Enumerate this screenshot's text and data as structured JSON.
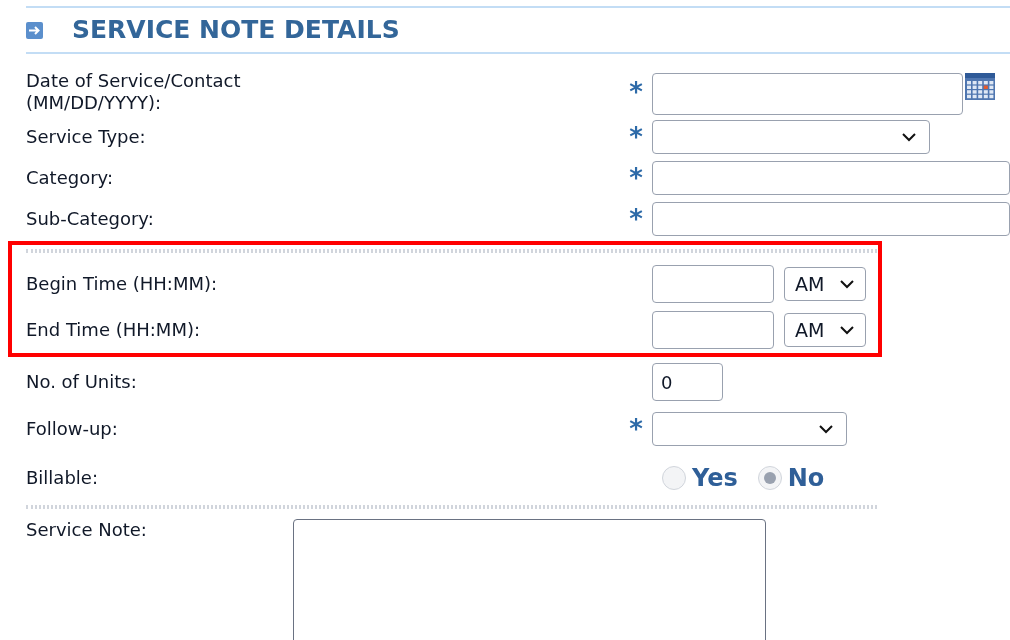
{
  "section": {
    "title": "SERVICE NOTE DETAILS"
  },
  "groups": [
    {
      "highlighted": false,
      "fields": [
        {
          "kind": "date",
          "label": "Date of Service/Contact (MM/DD/YYYY):",
          "required_mark": "*"
        },
        {
          "kind": "select",
          "label": "Service Type:",
          "required_mark": "*"
        },
        {
          "kind": "text",
          "label": "Category:",
          "required_mark": "*"
        },
        {
          "kind": "text",
          "label": "Sub-Category:",
          "required_mark": "*"
        }
      ]
    },
    {
      "highlighted": true,
      "fields": [
        {
          "kind": "time",
          "label": "Begin Time (HH:MM):",
          "period": "AM"
        },
        {
          "kind": "time",
          "label": "End Time (HH:MM):",
          "period": "AM"
        }
      ]
    },
    {
      "highlighted": false,
      "fields": [
        {
          "kind": "number",
          "label": "No. of Units:",
          "value": "0"
        },
        {
          "kind": "small_select",
          "label": "Follow-up:",
          "required_mark": "*"
        },
        {
          "kind": "radio",
          "label": "Billable:",
          "disabled": true,
          "options": [
            {
              "label": "Yes",
              "selected": false
            },
            {
              "label": "No",
              "selected": true
            }
          ]
        }
      ]
    }
  ],
  "note": {
    "label": "Service Note:"
  }
}
